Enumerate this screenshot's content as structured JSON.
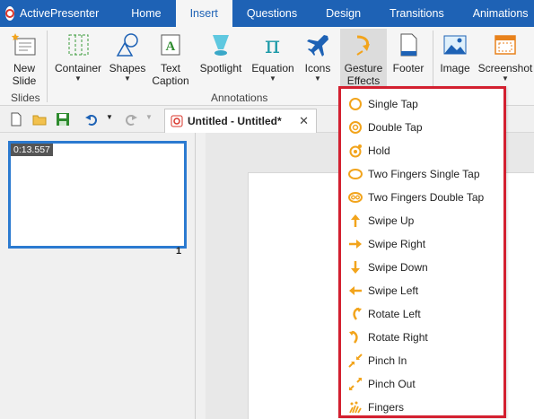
{
  "app": {
    "name": "ActivePresenter"
  },
  "tabs": [
    {
      "label": "Home",
      "active": false
    },
    {
      "label": "Insert",
      "active": true
    },
    {
      "label": "Questions",
      "active": false
    },
    {
      "label": "Design",
      "active": false
    },
    {
      "label": "Transitions",
      "active": false
    },
    {
      "label": "Animations",
      "active": false
    }
  ],
  "ribbon": {
    "new_slide": {
      "line1": "New",
      "line2": "Slide"
    },
    "slides_group": "Slides",
    "container": "Container",
    "shapes": "Shapes",
    "text_caption": {
      "line1": "Text",
      "line2": "Caption"
    },
    "spotlight": "Spotlight",
    "equation": "Equation",
    "icons": "Icons",
    "gesture_effects": {
      "line1": "Gesture",
      "line2": "Effects"
    },
    "footer": "Footer",
    "annotations_group": "Annotations",
    "image": "Image",
    "screenshot": "Screenshot",
    "accent_color": "#1e62b5",
    "gesture_color": "#f2a41c"
  },
  "document": {
    "tab_title": "Untitled - Untitled*",
    "close_glyph": "✕"
  },
  "slides": [
    {
      "timestamp": "0:13.557",
      "number": "1"
    }
  ],
  "gesture_menu": {
    "items": [
      {
        "label": "Single Tap",
        "icon": "single-tap-icon"
      },
      {
        "label": "Double Tap",
        "icon": "double-tap-icon"
      },
      {
        "label": "Hold",
        "icon": "hold-icon"
      },
      {
        "label": "Two Fingers Single Tap",
        "icon": "two-fingers-single-tap-icon"
      },
      {
        "label": "Two Fingers Double Tap",
        "icon": "two-fingers-double-tap-icon"
      },
      {
        "label": "Swipe Up",
        "icon": "swipe-up-icon"
      },
      {
        "label": "Swipe Right",
        "icon": "swipe-right-icon"
      },
      {
        "label": "Swipe Down",
        "icon": "swipe-down-icon"
      },
      {
        "label": "Swipe Left",
        "icon": "swipe-left-icon"
      },
      {
        "label": "Rotate Left",
        "icon": "rotate-left-icon"
      },
      {
        "label": "Rotate Right",
        "icon": "rotate-right-icon"
      },
      {
        "label": "Pinch In",
        "icon": "pinch-in-icon"
      },
      {
        "label": "Pinch Out",
        "icon": "pinch-out-icon"
      },
      {
        "label": "Fingers",
        "icon": "fingers-icon"
      }
    ],
    "border_color": "#d32030"
  }
}
